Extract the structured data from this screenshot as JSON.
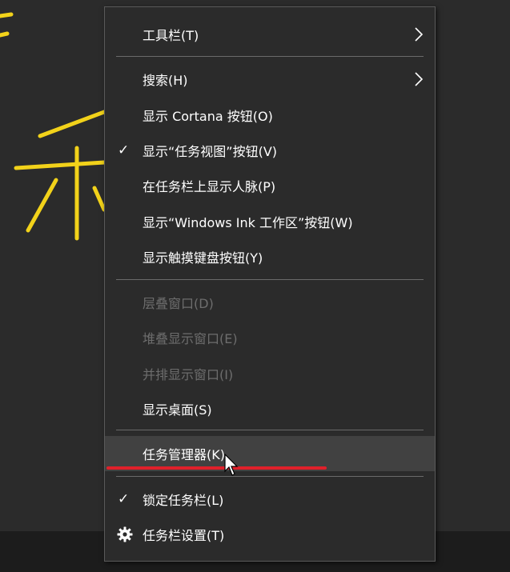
{
  "menu": {
    "items": [
      {
        "label": "工具栏(T)",
        "submenu": true
      },
      {
        "label": "搜索(H)",
        "submenu": true
      },
      {
        "label": "显示 Cortana 按钮(O)"
      },
      {
        "label": "显示“任务视图”按钮(V)",
        "checked": true
      },
      {
        "label": "在任务栏上显示人脉(P)"
      },
      {
        "label": "显示“Windows Ink 工作区”按钮(W)"
      },
      {
        "label": "显示触摸键盘按钮(Y)"
      },
      {
        "label": "层叠窗口(D)",
        "disabled": true
      },
      {
        "label": "堆叠显示窗口(E)",
        "disabled": true
      },
      {
        "label": "并排显示窗口(I)",
        "disabled": true
      },
      {
        "label": "显示桌面(S)"
      },
      {
        "label": "任务管理器(K)",
        "hovered": true
      },
      {
        "label": "锁定任务栏(L)",
        "checked": true
      },
      {
        "label": "任务栏设置(T)",
        "icon": "gear-icon"
      }
    ]
  },
  "icons": {
    "check": "✓"
  },
  "colors": {
    "menu_bg": "#2b2b2b",
    "text": "#ffffff",
    "disabled_text": "#6d6d6d",
    "hover_bg": "#414141",
    "annotation": "#e0202a",
    "handwriting": "#f2d21a"
  }
}
